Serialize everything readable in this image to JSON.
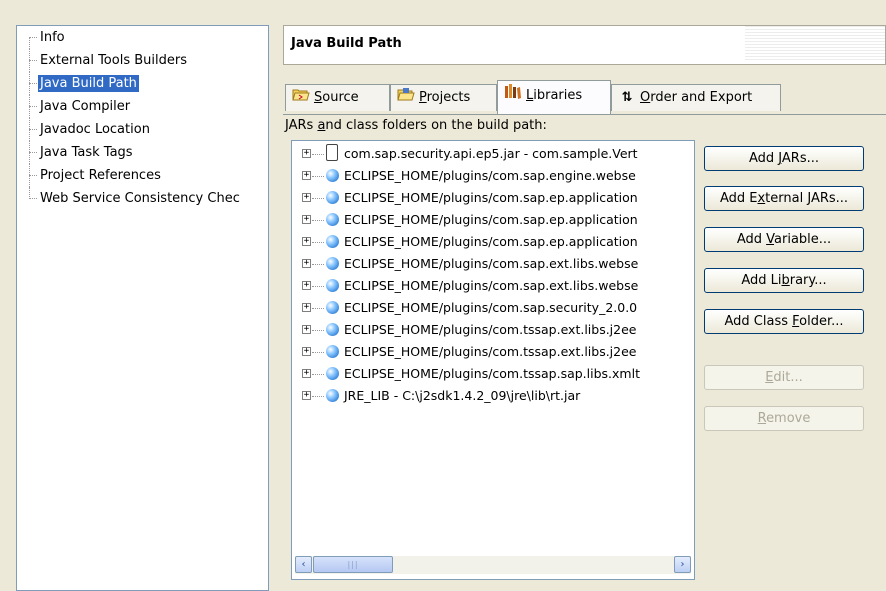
{
  "tree": {
    "items": [
      {
        "label": "Info",
        "selected": false
      },
      {
        "label": "External Tools Builders",
        "selected": false
      },
      {
        "label": "Java Build Path",
        "selected": true
      },
      {
        "label": "Java Compiler",
        "selected": false
      },
      {
        "label": "Javadoc Location",
        "selected": false
      },
      {
        "label": "Java Task Tags",
        "selected": false
      },
      {
        "label": "Project References",
        "selected": false
      },
      {
        "label": "Web Service Consistency Chec",
        "selected": false
      }
    ]
  },
  "header": {
    "title": "Java Build Path"
  },
  "tabs": {
    "source": {
      "m": "S",
      "r": "ource",
      "icon": "folder-source-icon"
    },
    "projects": {
      "m": "P",
      "r": "rojects",
      "icon": "folder-projects-icon"
    },
    "libraries": {
      "m": "L",
      "r": "ibraries",
      "icon": "books-icon",
      "active": true
    },
    "order": {
      "m": "O",
      "r": "rder and Export",
      "icon": "sort-arrows-icon"
    }
  },
  "list_caption": {
    "a": "JARs ",
    "m": "a",
    "b": "nd class folders on the build path:"
  },
  "libraries": [
    {
      "text": "com.sap.security.api.ep5.jar - com.sample.Vert",
      "icon": "jar-icon"
    },
    {
      "text": "ECLIPSE_HOME/plugins/com.sap.engine.webse",
      "icon": "variable-icon"
    },
    {
      "text": "ECLIPSE_HOME/plugins/com.sap.ep.application",
      "icon": "variable-icon"
    },
    {
      "text": "ECLIPSE_HOME/plugins/com.sap.ep.application",
      "icon": "variable-icon"
    },
    {
      "text": "ECLIPSE_HOME/plugins/com.sap.ep.application",
      "icon": "variable-icon"
    },
    {
      "text": "ECLIPSE_HOME/plugins/com.sap.ext.libs.webse",
      "icon": "variable-icon"
    },
    {
      "text": "ECLIPSE_HOME/plugins/com.sap.ext.libs.webse",
      "icon": "variable-icon"
    },
    {
      "text": "ECLIPSE_HOME/plugins/com.sap.security_2.0.0",
      "icon": "variable-icon"
    },
    {
      "text": "ECLIPSE_HOME/plugins/com.tssap.ext.libs.j2ee",
      "icon": "variable-icon"
    },
    {
      "text": "ECLIPSE_HOME/plugins/com.tssap.ext.libs.j2ee",
      "icon": "variable-icon"
    },
    {
      "text": "ECLIPSE_HOME/plugins/com.tssap.sap.libs.xmlt",
      "icon": "variable-icon"
    },
    {
      "text": "JRE_LIB - C:\\j2sdk1.4.2_09\\jre\\lib\\rt.jar",
      "icon": "variable-icon"
    }
  ],
  "buttons": {
    "add_jars": {
      "a": "Add ",
      "m": "J",
      "b": "ARs..."
    },
    "add_external_jars": {
      "a": "Add E",
      "m": "x",
      "b": "ternal JARs..."
    },
    "add_variable": {
      "a": "Add ",
      "m": "V",
      "b": "ariable..."
    },
    "add_library": {
      "a": "Add Li",
      "m": "b",
      "b": "rary..."
    },
    "add_class_folder": {
      "a": "Add Class ",
      "m": "F",
      "b": "older..."
    },
    "edit": {
      "a": "",
      "m": "E",
      "b": "dit...",
      "disabled": true
    },
    "remove": {
      "a": "",
      "m": "R",
      "b": "emove",
      "disabled": true
    }
  },
  "scrollbar": {
    "left_arrow": "‹",
    "right_arrow": "›",
    "grip": "|||"
  }
}
